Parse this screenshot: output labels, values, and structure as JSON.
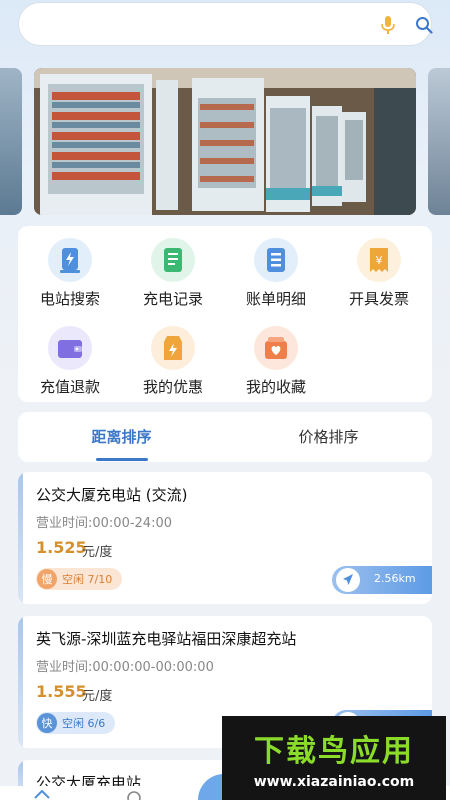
{
  "search": {
    "placeholder": "",
    "value": ""
  },
  "icons": {
    "mic": "microphone-icon",
    "search": "search-icon",
    "navigate": "navigation-arrow-icon"
  },
  "colors": {
    "accent": "#3b78c9",
    "price": "#d5902c",
    "watermark_green": "#8bdc2a"
  },
  "menu": [
    {
      "label": "电站搜索",
      "icon": "station-search-icon"
    },
    {
      "label": "充电记录",
      "icon": "charge-record-icon"
    },
    {
      "label": "账单明细",
      "icon": "bill-detail-icon"
    },
    {
      "label": "开具发票",
      "icon": "invoice-icon"
    },
    {
      "label": "充值退款",
      "icon": "wallet-icon"
    },
    {
      "label": "我的优惠",
      "icon": "coupon-icon"
    },
    {
      "label": "我的收藏",
      "icon": "favorite-icon"
    }
  ],
  "tabs": {
    "distance": "距离排序",
    "price": "价格排序",
    "active": "distance"
  },
  "stations": [
    {
      "name": "公交大厦充电站 (交流)",
      "hours": "营业时间:00:00-24:00",
      "price": "1.525",
      "unit": "元/度",
      "badge": "慢",
      "status": "空闲 7/10",
      "distance": "2.56km"
    },
    {
      "name": "英飞源-深圳蓝充电驿站福田深康超充站",
      "hours": "营业时间:00:00:00-00:00:00",
      "price": "1.555",
      "unit": "元/度",
      "badge": "快",
      "status": "空闲 6/6",
      "distance": ""
    },
    {
      "name": "公交大厦充电站",
      "hours": "",
      "price": "",
      "unit": "",
      "badge": "",
      "status": "",
      "distance": ""
    }
  ],
  "watermark": {
    "title": "下载鸟应用",
    "url": "www.xiazainiao.com"
  }
}
